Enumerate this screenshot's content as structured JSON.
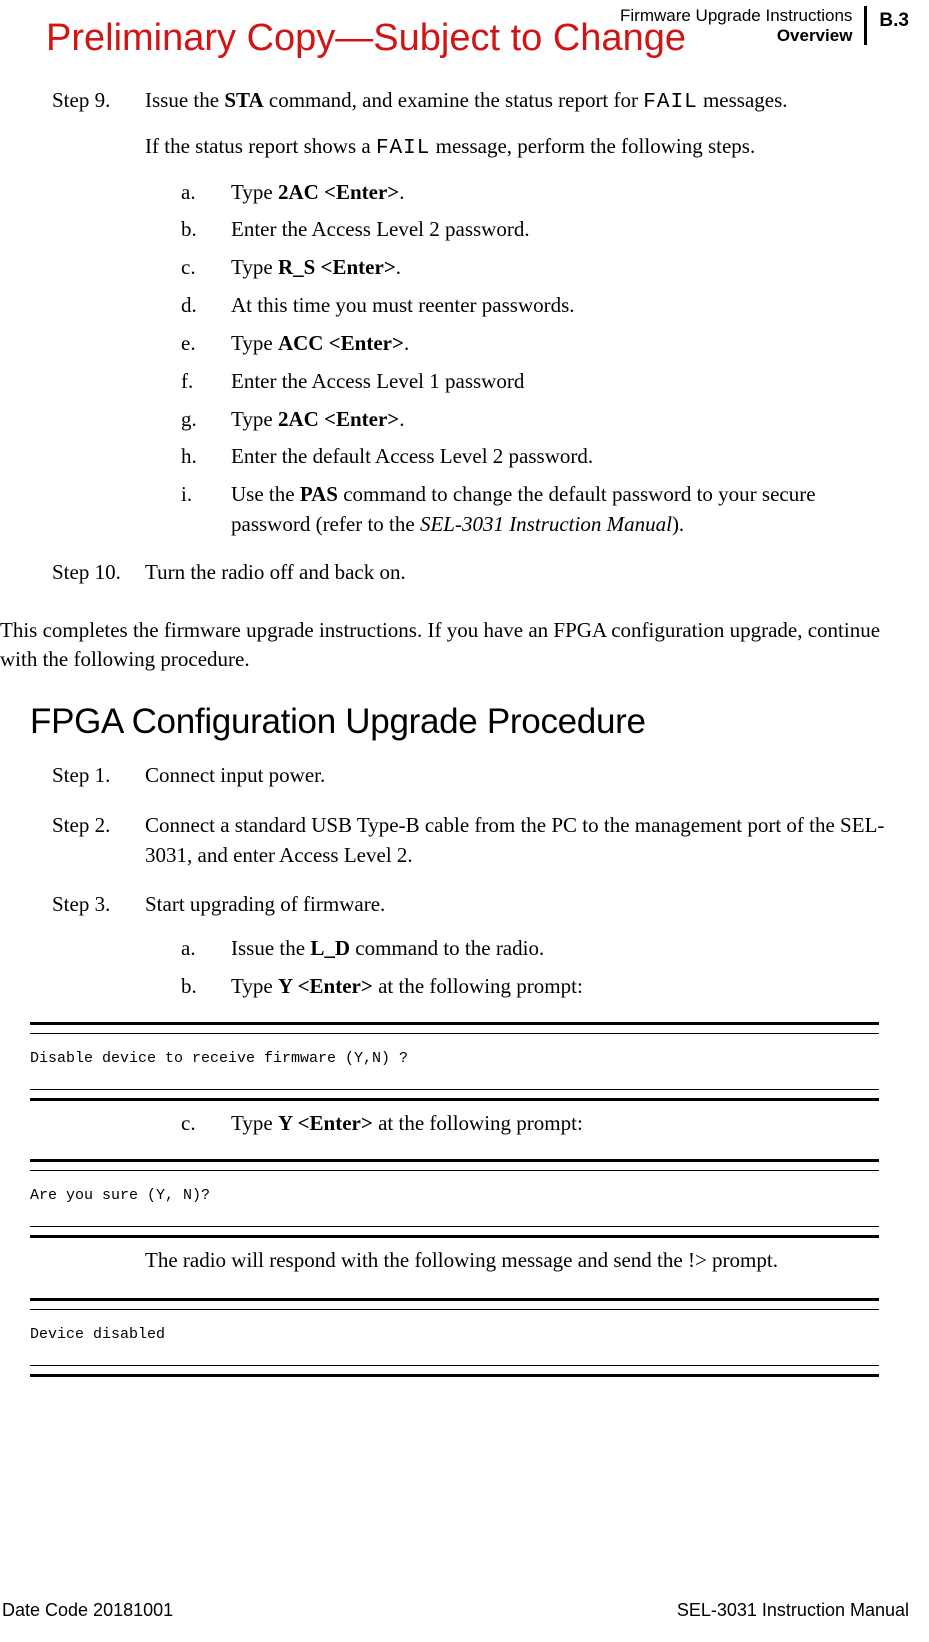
{
  "header": {
    "title": "Firmware Upgrade Instructions",
    "subtitle": "Overview",
    "page_number": "B.3"
  },
  "watermark": "Preliminary Copy—Subject to Change",
  "steps": {
    "step9": {
      "label": "Step 9.",
      "intro_pre": "Issue the ",
      "intro_bold": "STA",
      "intro_mid": " command, and examine the status report for ",
      "intro_mono": "FAIL",
      "intro_post": " messages.",
      "cond_pre": "If the status report shows a ",
      "cond_mono": "FAIL",
      "cond_post": " message, perform the following steps.",
      "subs": {
        "a": {
          "letter": "a.",
          "pre": "Type ",
          "bold": "2AC <Enter>",
          "post": "."
        },
        "b": {
          "letter": "b.",
          "text": "Enter the Access Level 2 password."
        },
        "c": {
          "letter": "c.",
          "pre": "Type ",
          "bold": "R_S <Enter>",
          "post": "."
        },
        "d": {
          "letter": "d.",
          "text": "At this time you must reenter passwords."
        },
        "e": {
          "letter": "e.",
          "pre": "Type ",
          "bold": "ACC <Enter>",
          "post": "."
        },
        "f": {
          "letter": "f.",
          "text": "Enter the Access Level 1 password"
        },
        "g": {
          "letter": "g.",
          "pre": "Type ",
          "bold": "2AC <Enter>",
          "post": "."
        },
        "h": {
          "letter": "h.",
          "text": "Enter the default Access Level 2 password."
        },
        "i": {
          "letter": "i.",
          "pre": "Use the ",
          "bold": "PAS",
          "mid": " command to change the default password to your secure password (refer to the ",
          "ital": "SEL-3031 Instruction Manual",
          "post": ")."
        }
      }
    },
    "step10": {
      "label": "Step 10.",
      "text": "Turn the radio off and back on."
    }
  },
  "completion_text": "This completes the firmware upgrade instructions. If you have an FPGA configuration upgrade, continue with the following procedure.",
  "fpga": {
    "heading": "FPGA Configuration Upgrade Procedure",
    "step1": {
      "label": "Step 1.",
      "text": "Connect input power."
    },
    "step2": {
      "label": "Step 2.",
      "text": "Connect a standard USB Type-B cable from the PC to the management port of the SEL-3031, and enter Access Level 2."
    },
    "step3": {
      "label": "Step 3.",
      "text": "Start upgrading of firmware.",
      "subs": {
        "a": {
          "letter": "a.",
          "pre": "Issue the ",
          "bold": "L_D",
          "post": " command to the radio."
        },
        "b": {
          "letter": "b.",
          "pre": "Type ",
          "bold": "Y <Enter>",
          "post": " at the following prompt:"
        },
        "c": {
          "letter": "c.",
          "pre": "Type ",
          "bold": "Y <Enter>",
          "post": " at the following prompt:"
        }
      }
    }
  },
  "terminals": {
    "t1": "Disable device to receive firmware (Y,N) ?",
    "t2": "Are you sure (Y, N)?",
    "t3": "Device disabled"
  },
  "radio_respond": "The radio will respond with the following message and send the !> prompt.",
  "footer": {
    "left": "Date Code 20181001",
    "right": "SEL-3031 Instruction Manual"
  }
}
